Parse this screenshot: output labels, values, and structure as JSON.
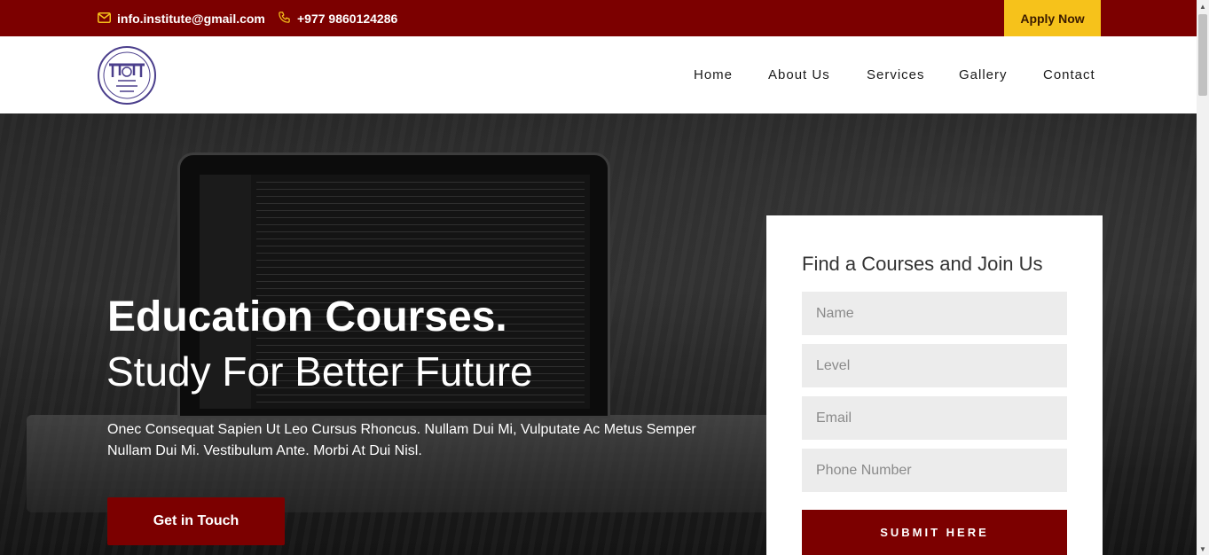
{
  "topbar": {
    "email": "info.institute@gmail.com",
    "phone": "+977 9860124286",
    "apply_label": "Apply Now",
    "email_icon": "mail-icon",
    "phone_icon": "phone-icon"
  },
  "nav": {
    "items": [
      "Home",
      "About Us",
      "Services",
      "Gallery",
      "Contact"
    ]
  },
  "hero": {
    "title": "Education Courses.",
    "subtitle": "Study For Better Future",
    "text": "Onec Consequat Sapien Ut Leo Cursus Rhoncus. Nullam Dui Mi, Vulputate Ac Metus Semper Nullam Dui Mi. Vestibulum Ante. Morbi At Dui Nisl.",
    "cta_label": "Get in Touch"
  },
  "form": {
    "title": "Find a Courses and Join Us",
    "fields": [
      {
        "placeholder": "Name"
      },
      {
        "placeholder": "Level"
      },
      {
        "placeholder": "Email"
      },
      {
        "placeholder": "Phone Number"
      }
    ],
    "submit_label": "SUBMIT HERE"
  },
  "colors": {
    "primary": "#7c0000",
    "accent": "#f6c21b"
  }
}
